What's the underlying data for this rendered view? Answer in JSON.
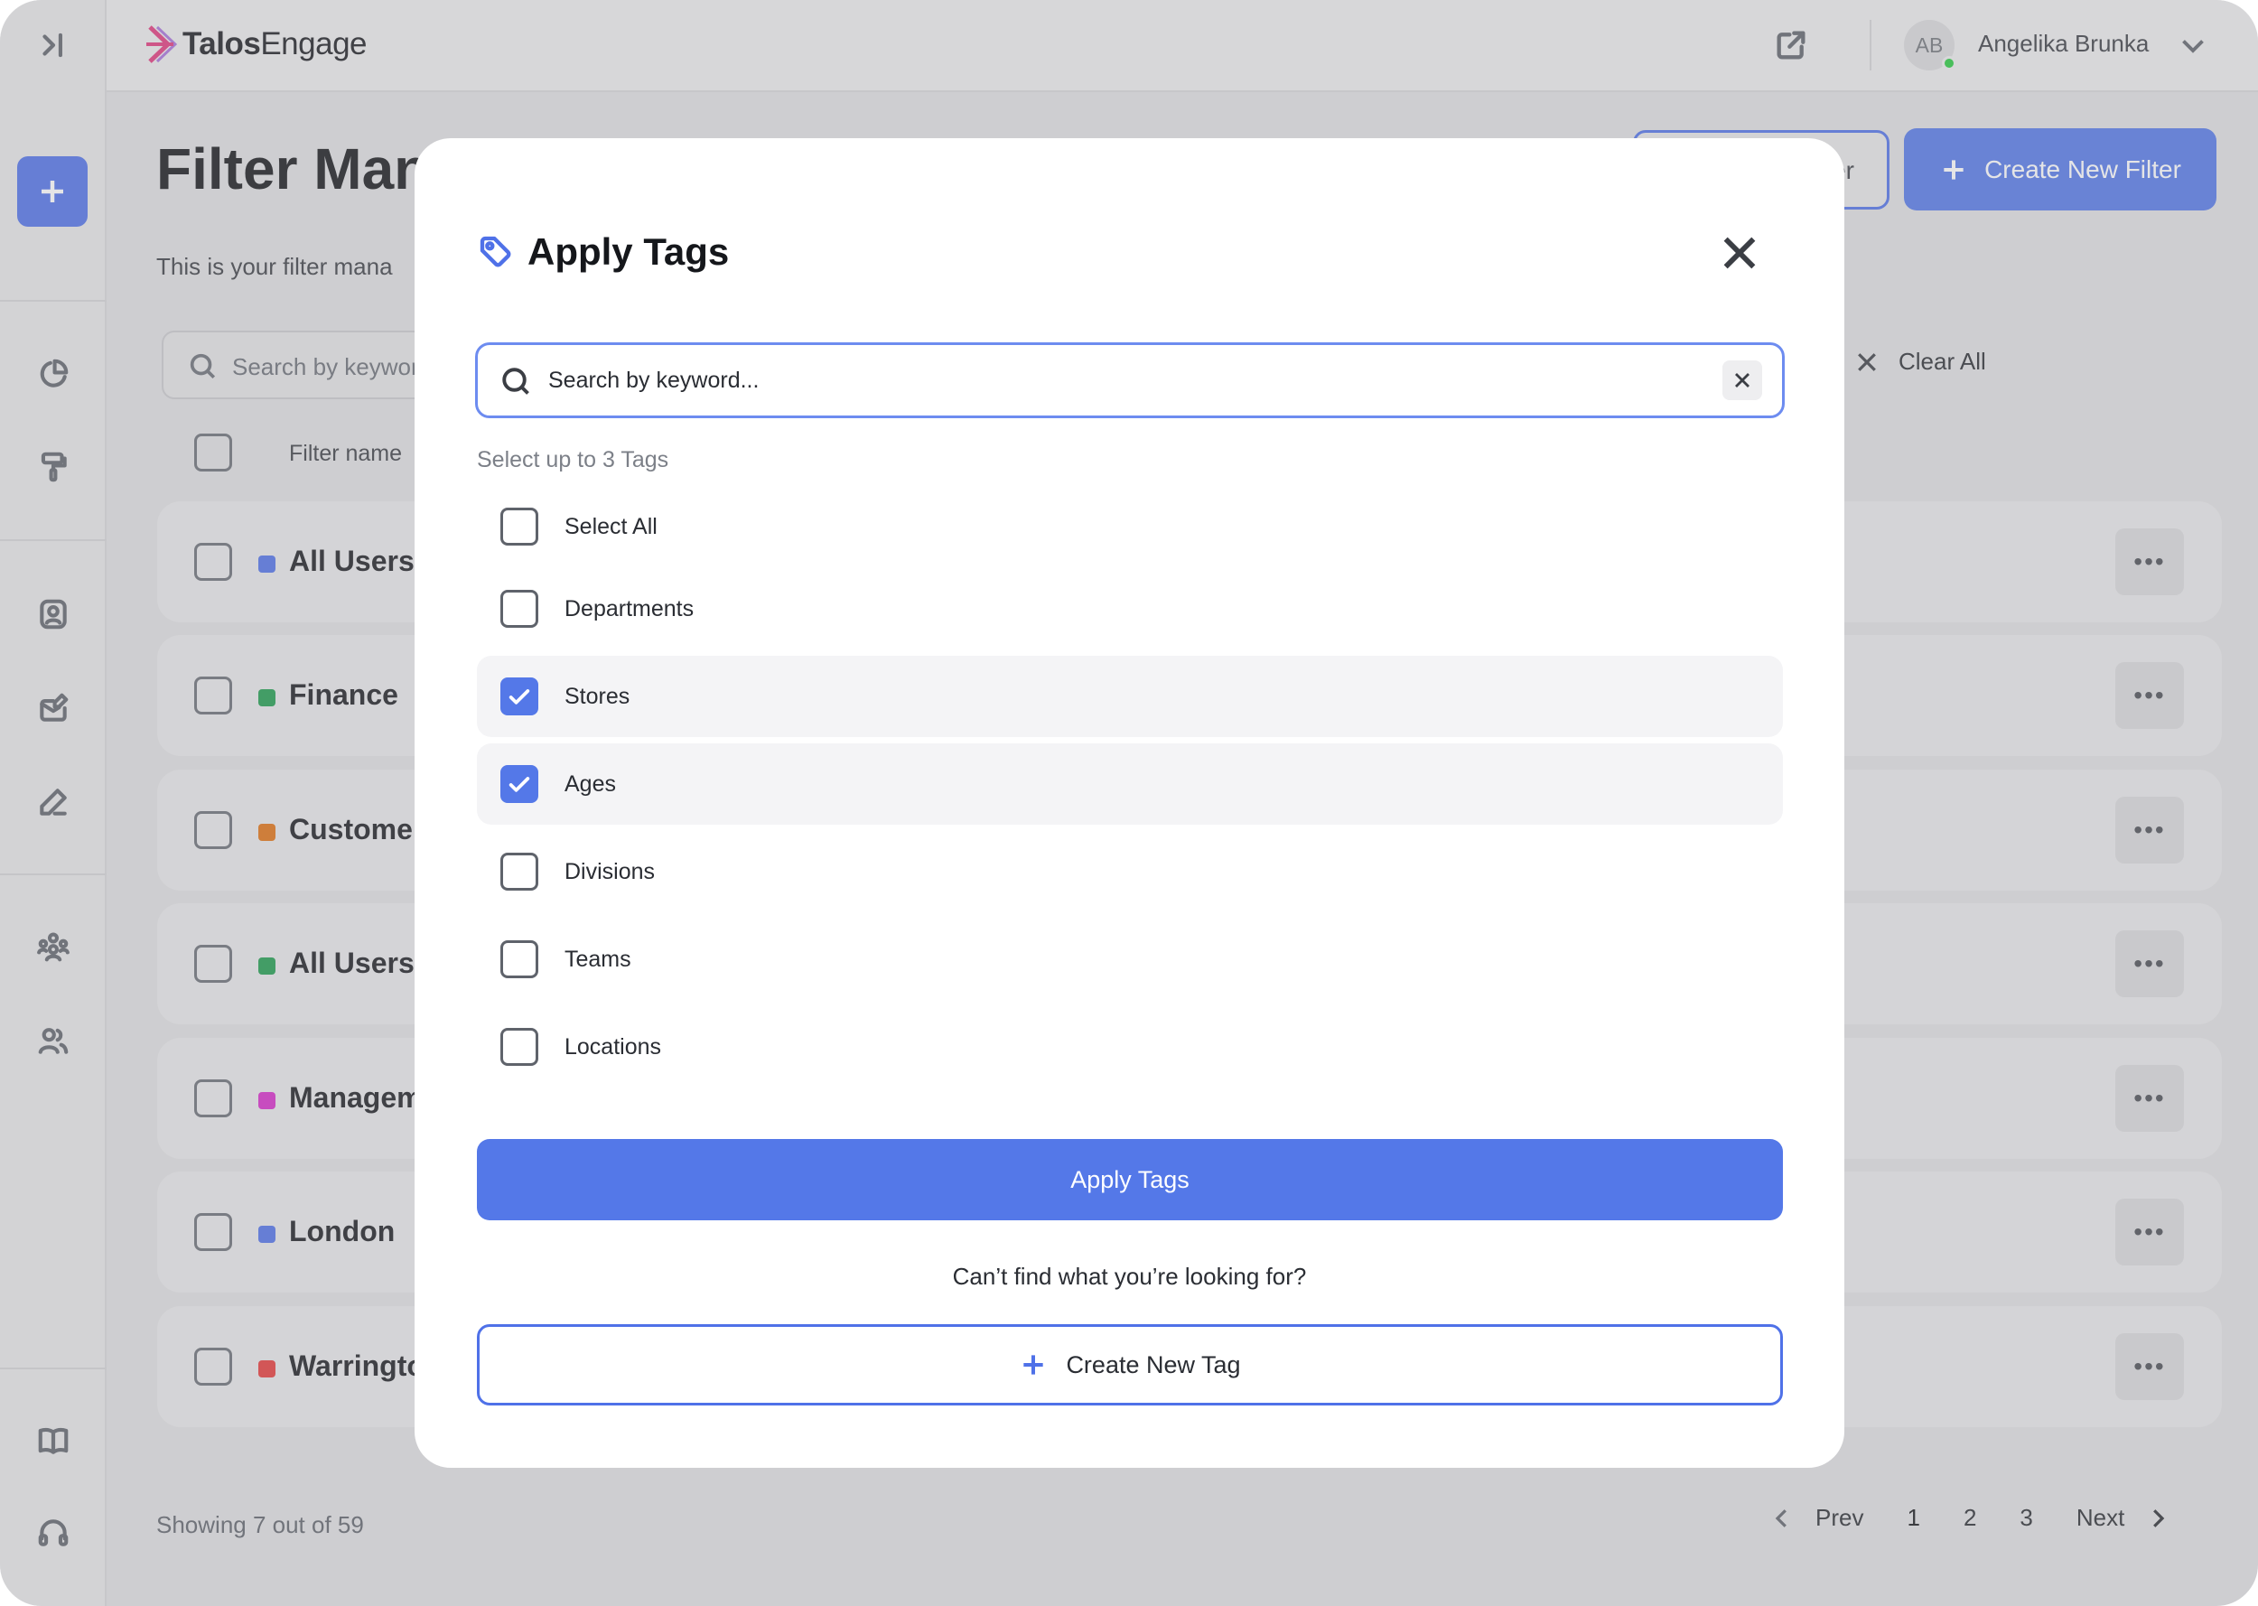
{
  "app": {
    "brand_bold": "Talos",
    "brand_light": "Engage",
    "user_initials": "AB",
    "user_name": "Angelika Brunka"
  },
  "sidebar": {
    "icons": [
      "expand-sidebar-icon",
      "add-icon",
      "pie-chart-icon",
      "paint-roller-icon",
      "contact-card-icon",
      "mail-edit-icon",
      "pen-icon",
      "groups-icon",
      "users-icon",
      "book-icon",
      "headset-icon"
    ]
  },
  "page": {
    "title": "Filter Man",
    "subtitle": "This is your filter mana",
    "secondary_button": "er",
    "create_filter_button": "Create New Filter",
    "search_placeholder": "Search by keywor",
    "clear_all": "Clear All",
    "column_filter_name": "Filter name",
    "rows": [
      {
        "name": "All Users I",
        "color": "#4f71e8"
      },
      {
        "name": "Finance",
        "color": "#1f9b4e"
      },
      {
        "name": "Customer",
        "color": "#e07112"
      },
      {
        "name": "All Users I",
        "color": "#1f9b4e"
      },
      {
        "name": "Managem",
        "color": "#d62bc9"
      },
      {
        "name": "London",
        "color": "#4f71e8"
      },
      {
        "name": "Warringto",
        "color": "#e53939"
      }
    ],
    "more_label": "•••",
    "showing": "Showing 7 out of 59",
    "pager": {
      "prev": "Prev",
      "pages": [
        "1",
        "2",
        "3"
      ],
      "next": "Next"
    }
  },
  "modal": {
    "title": "Apply Tags",
    "search_placeholder": "Search by keyword...",
    "hint": "Select up to 3 Tags",
    "options": [
      {
        "label": "Select All",
        "checked": false
      },
      {
        "label": "Departments",
        "checked": false
      },
      {
        "label": "Stores",
        "checked": true
      },
      {
        "label": "Ages",
        "checked": true
      },
      {
        "label": "Divisions",
        "checked": false
      },
      {
        "label": "Teams",
        "checked": false
      },
      {
        "label": "Locations",
        "checked": false
      }
    ],
    "apply_button": "Apply Tags",
    "cant_find": "Can’t find what you’re looking for?",
    "create_tag_button": "Create New Tag"
  },
  "colors": {
    "accent": "#5478e8",
    "selected_row": "#f4f4f6"
  }
}
